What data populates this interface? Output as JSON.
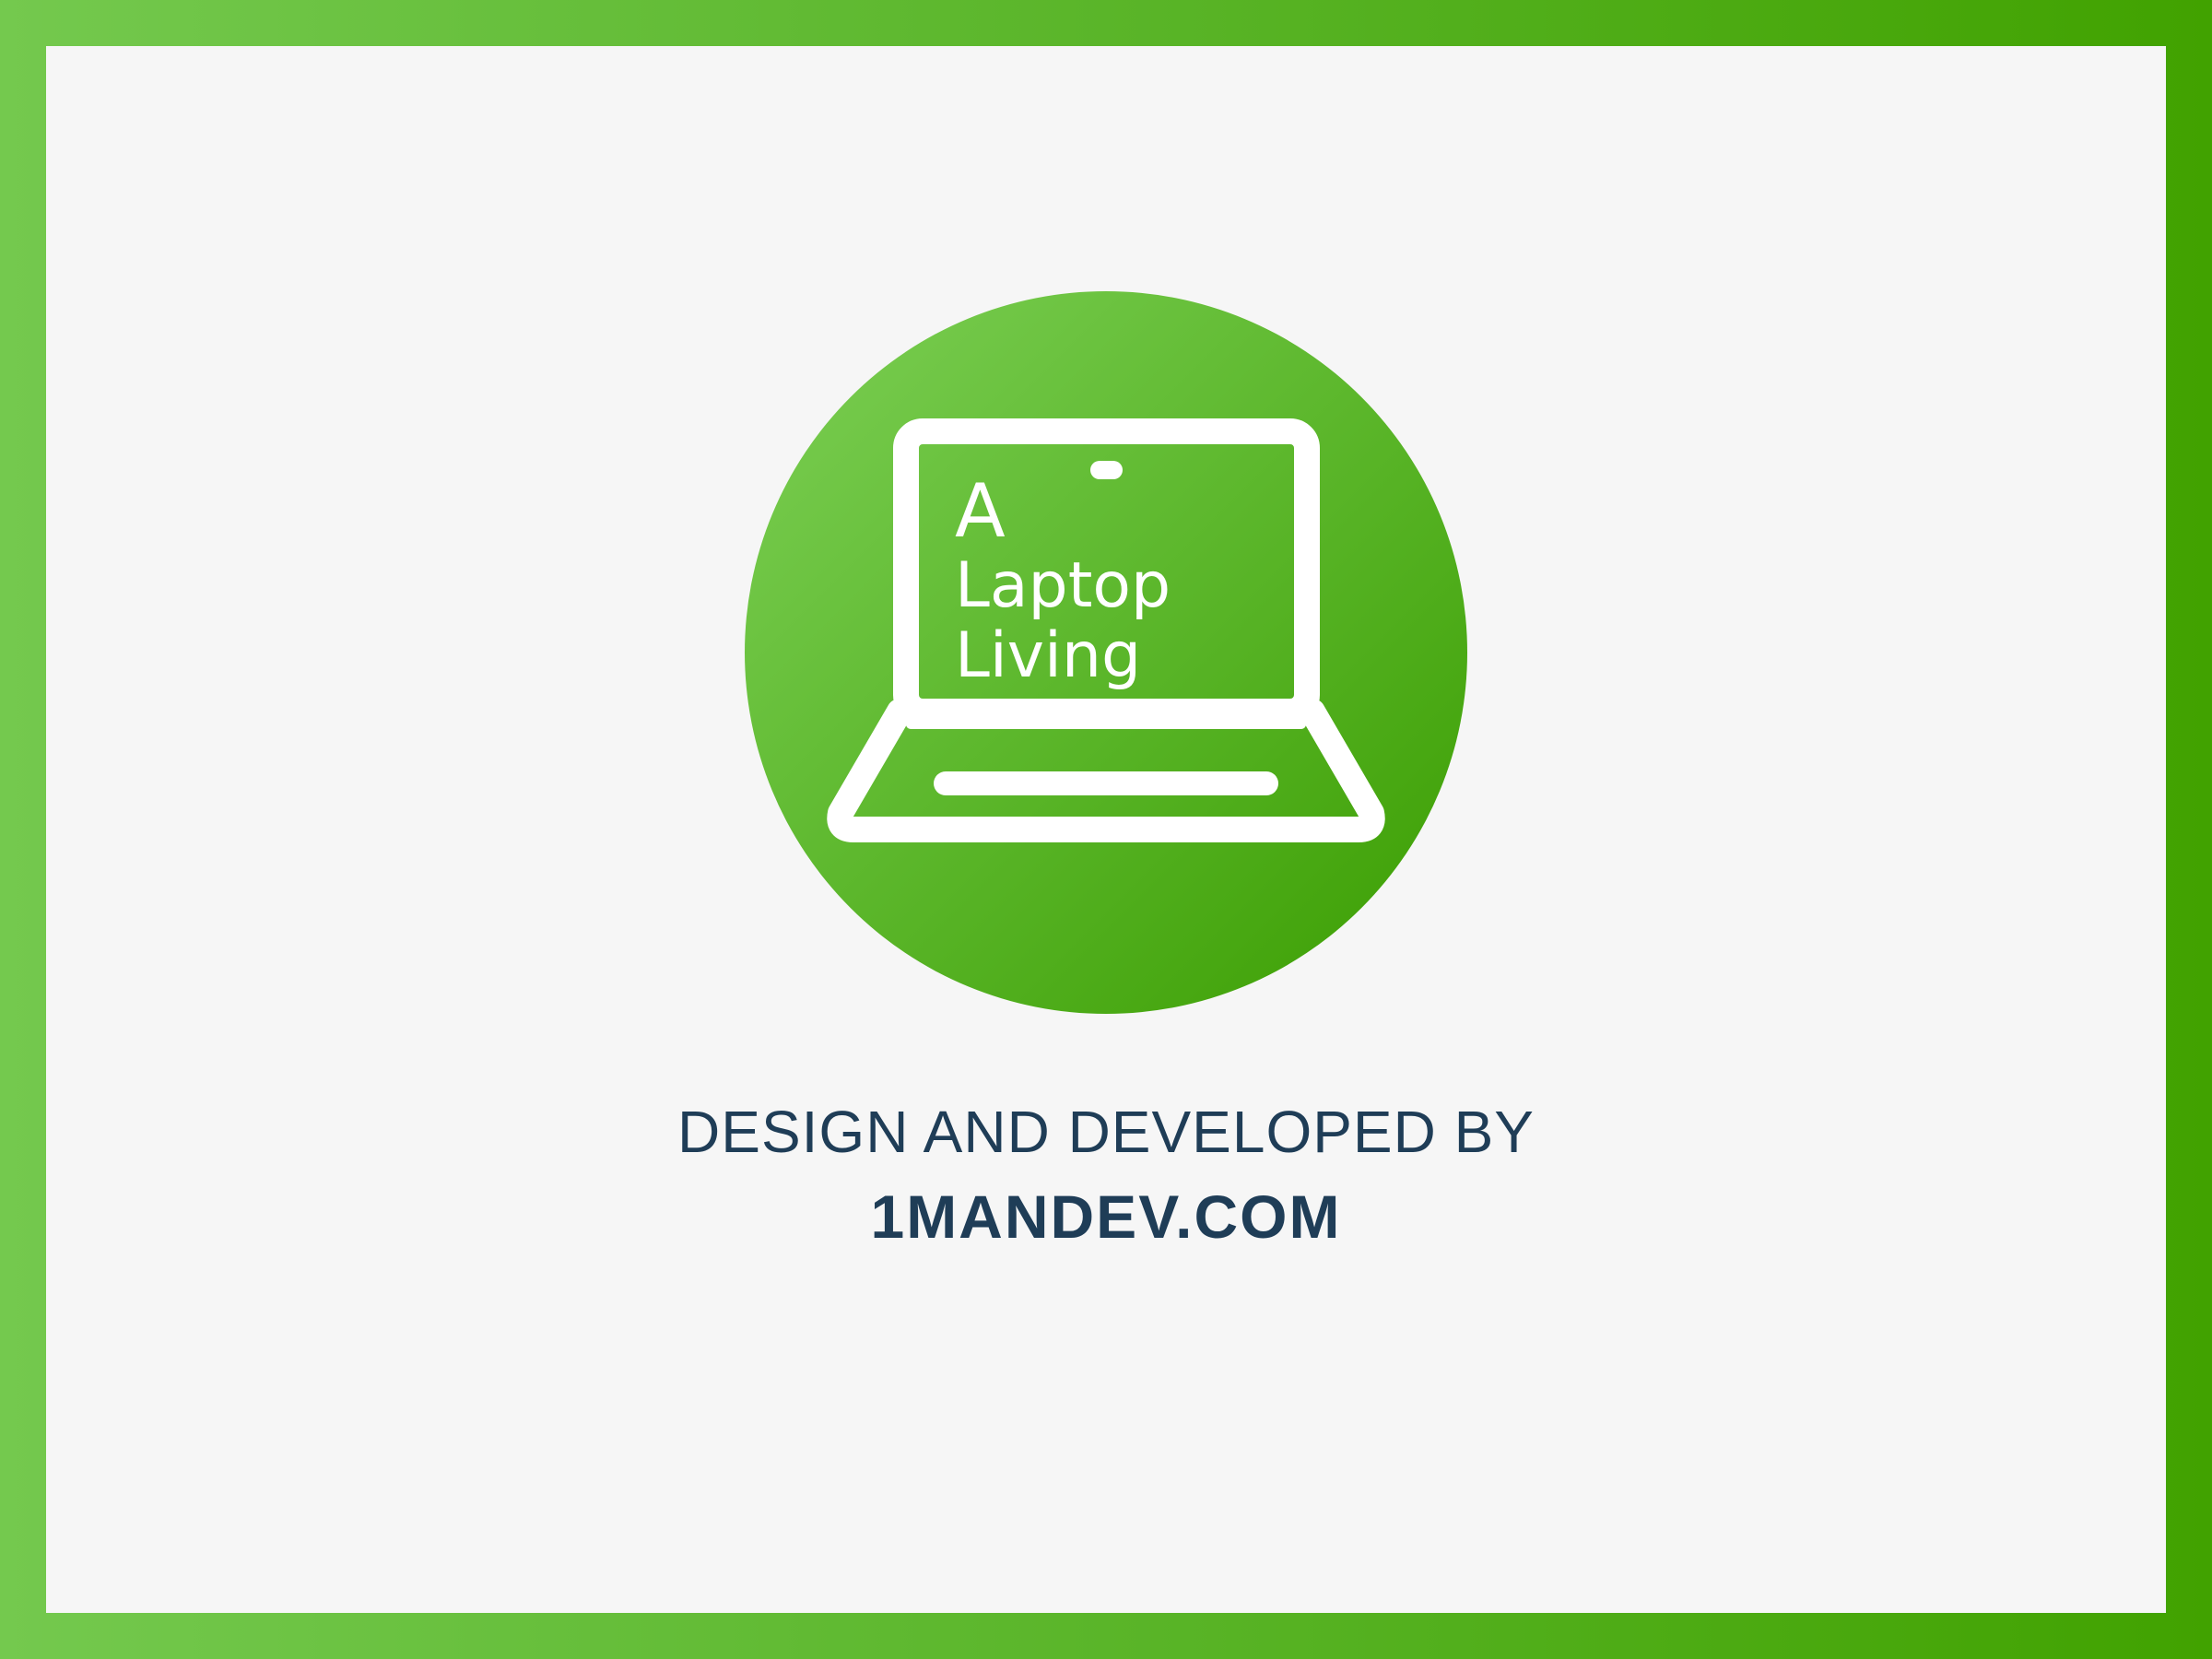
{
  "logo": {
    "line1": "A",
    "line2": "Laptop",
    "line3": "Living",
    "icon": "laptop-icon",
    "gradient_start": "#74c94e",
    "gradient_end": "#41a200"
  },
  "credit": {
    "label": "DESIGN AND DEVELOPED BY",
    "site": "1MANDEV.COM"
  },
  "colors": {
    "frame_start": "#74c94e",
    "frame_end": "#41a200",
    "panel": "#f6f6f6",
    "text": "#1f3d57",
    "icon_stroke": "#ffffff"
  }
}
